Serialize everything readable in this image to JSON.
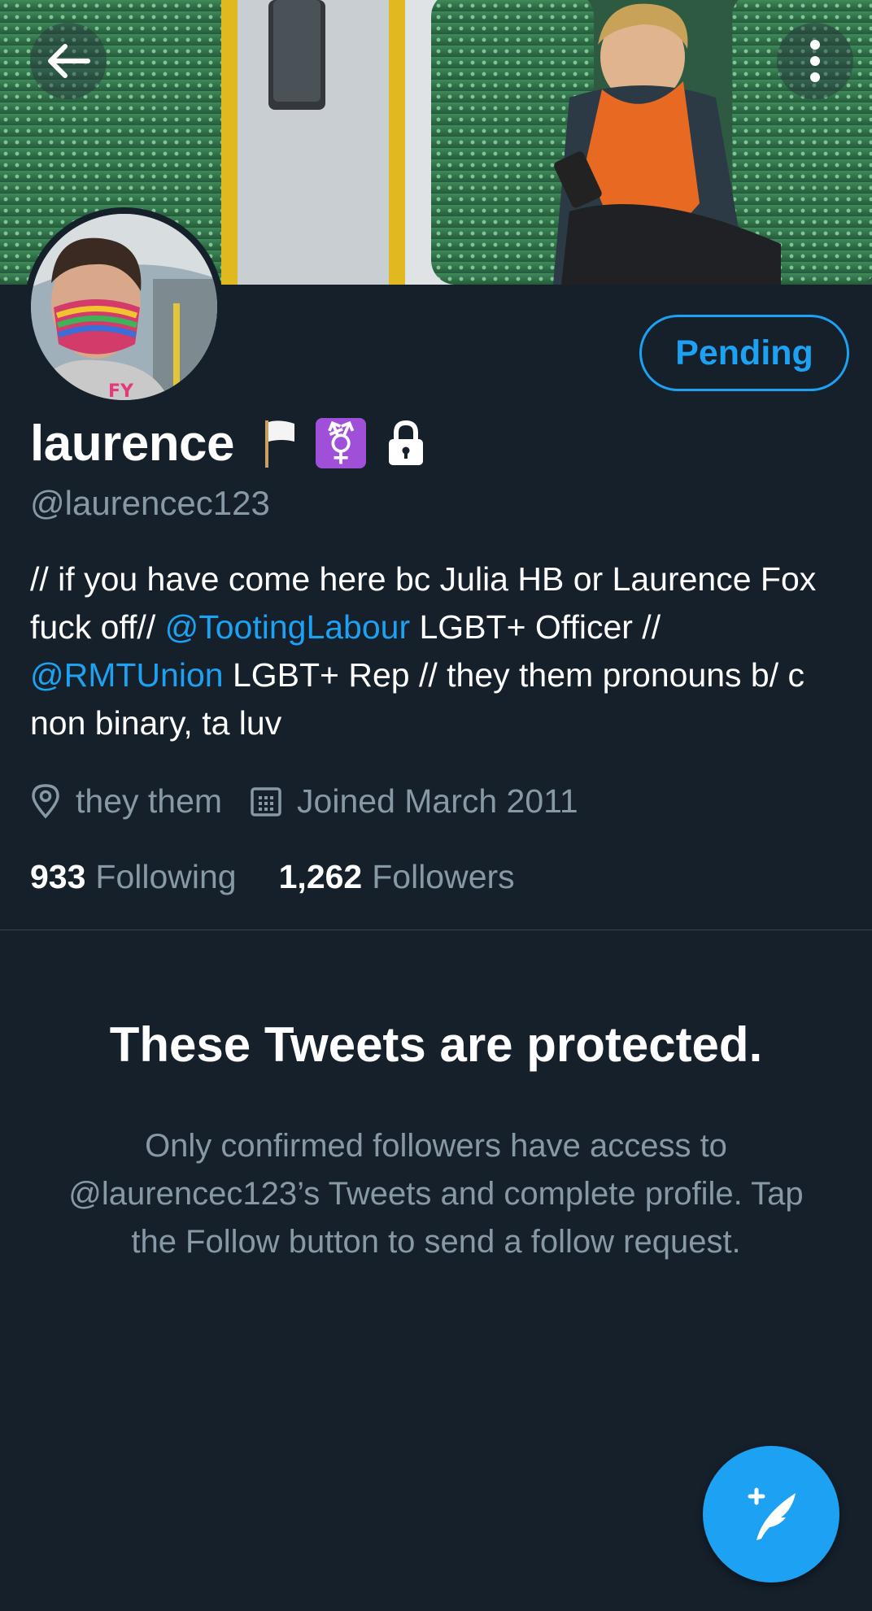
{
  "header": {
    "back_icon": "arrow-left-icon",
    "more_icon": "more-vertical-icon"
  },
  "profile": {
    "display_name": "laurence",
    "emojis": [
      "white-flag-emoji",
      "transgender-symbol-emoji",
      "lock-icon"
    ],
    "handle": "@laurencec123",
    "follow_state_label": "Pending",
    "bio": {
      "seg1": "// if you have come here bc Julia HB or Laurence Fox fuck off// ",
      "mention1": "@TootingLabour",
      "seg2": " LGBT+ Officer // ",
      "mention2": "@RMTUnion",
      "seg3": " LGBT+ Rep // they them pronouns b/ c non binary, ta luv"
    },
    "location": "they them",
    "joined": "Joined March 2011",
    "following_count": "933",
    "following_label": "Following",
    "followers_count": "1,262",
    "followers_label": "Followers"
  },
  "protected": {
    "title": "These Tweets are protected.",
    "body": "Only confirmed followers have access to @laurencec123’s Tweets and complete profile. Tap the Follow button to send a follow request."
  },
  "fab": {
    "icon": "compose-tweet-icon"
  },
  "colors": {
    "background": "#15202b",
    "accent": "#1da1f2",
    "secondary_text": "#8899a6",
    "divider": "#38444d"
  }
}
